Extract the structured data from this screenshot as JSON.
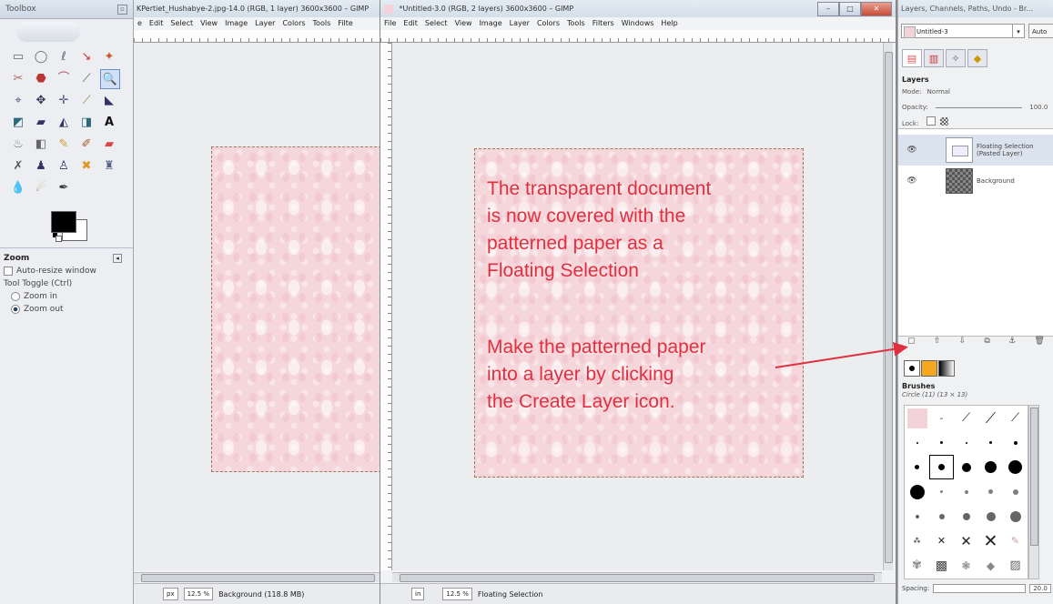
{
  "toolbox": {
    "title": "Toolbox",
    "zoom": {
      "title": "Zoom",
      "auto_resize_label": "Auto-resize window",
      "tool_toggle_label": "Tool Toggle  (Ctrl)",
      "zoom_in_label": "Zoom in",
      "zoom_out_label": "Zoom out",
      "zoom_out_selected": true
    }
  },
  "window1": {
    "title": "KPertiet_Hushabye-2.jpg-14.0 (RGB, 1 layer) 3600x3600 – GIMP",
    "menu": [
      "e",
      "Edit",
      "Select",
      "View",
      "Image",
      "Layer",
      "Colors",
      "Tools",
      "Filte"
    ],
    "status": {
      "unit": "px",
      "zoom": "12.5 %",
      "info": "Background (118.8 MB)"
    }
  },
  "window2": {
    "title": "*Untitled-3.0 (RGB, 2 layers) 3600x3600 – GIMP",
    "menu": [
      "File",
      "Edit",
      "Select",
      "View",
      "Image",
      "Layer",
      "Colors",
      "Tools",
      "Filters",
      "Windows",
      "Help"
    ],
    "status": {
      "unit": "in",
      "zoom": "12.5 %",
      "info": "Floating Selection"
    },
    "annotation": {
      "paragraph1": [
        "The transparent document",
        "is now covered with the",
        "patterned paper as a",
        "Floating Selection"
      ],
      "paragraph2": [
        "Make the patterned paper",
        "into a layer by clicking",
        "the Create Layer icon."
      ],
      "color": "#e03040"
    }
  },
  "dock": {
    "title": "Layers, Channels, Paths, Undo - Br...",
    "image_select": "Untitled-3",
    "auto_label": "Auto",
    "layers": {
      "title": "Layers",
      "mode_label": "Mode:",
      "mode_value": "Normal",
      "opacity_label": "Opacity:",
      "opacity_value": "100.0",
      "lock_label": "Lock:",
      "items": [
        {
          "name": "Floating Selection\n(Pasted Layer)",
          "visible": true,
          "thumb": "floating"
        },
        {
          "name": "Background",
          "visible": true,
          "thumb": "checker"
        }
      ]
    },
    "brushes": {
      "title": "Brushes",
      "current": "Circle (11) (13 × 13)",
      "spacing_label": "Spacing:",
      "spacing_value": "20.0"
    }
  }
}
